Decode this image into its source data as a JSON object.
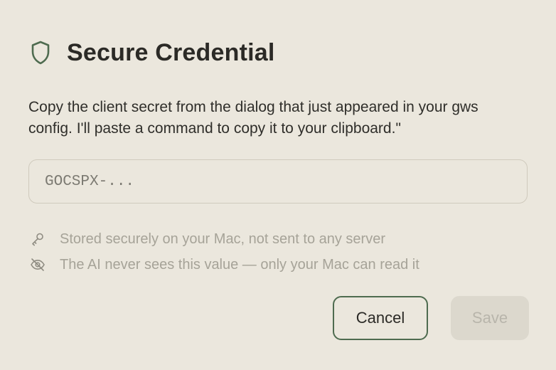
{
  "dialog": {
    "title": "Secure Credential",
    "title_icon": "shield-icon",
    "description": "Copy the client secret from the dialog that just appeared in your gws config. I'll paste a command to copy it to your clipboard.\"",
    "input": {
      "value": "",
      "placeholder": "GOCSPX-..."
    },
    "notes": [
      {
        "icon": "key-icon",
        "text": "Stored securely on your Mac, not sent to any server"
      },
      {
        "icon": "eye-off-icon",
        "text": "The AI never sees this value — only your Mac can read it"
      }
    ],
    "buttons": {
      "cancel_label": "Cancel",
      "save_label": "Save",
      "save_enabled": false
    }
  },
  "colors": {
    "background": "#ebe7dd",
    "accent": "#4e6b4f",
    "muted_text": "#a6a398",
    "disabled_button_bg": "#dcd8cd"
  }
}
